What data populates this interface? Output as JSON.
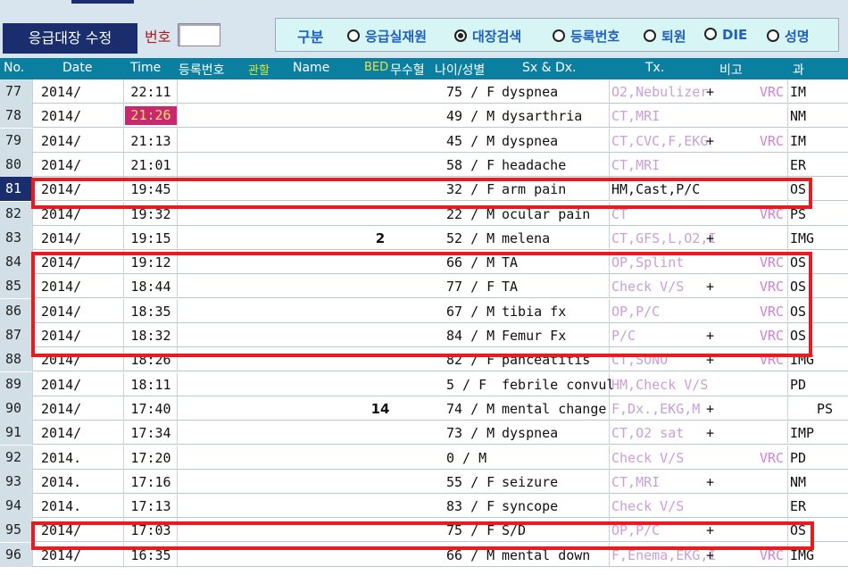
{
  "toolbar": {
    "title": "응급대장 수정",
    "number_label": "번호",
    "number_value": "",
    "group_label": "구분",
    "options": [
      {
        "label": "응급실재원",
        "selected": false
      },
      {
        "label": "대장검색",
        "selected": true
      },
      {
        "label": "등록번호",
        "selected": false
      },
      {
        "label": "퇴원",
        "selected": false
      },
      {
        "label": "DIE",
        "selected": false
      },
      {
        "label": "성명",
        "selected": false
      }
    ]
  },
  "columns": {
    "no": "No.",
    "date": "Date",
    "time": "Time",
    "reg": "등록번호",
    "dept_watch": "관할",
    "name": "Name",
    "bed": "BED",
    "trans": "무수혈",
    "age_sex": "나이/성별",
    "sxdx": "Sx & Dx.",
    "tx": "Tx.",
    "note": "비고",
    "dept": "과"
  },
  "rows": [
    {
      "no": "77",
      "date": "2014/",
      "time": "22:11",
      "bed": "",
      "age_sex": "75 / F",
      "dx": "dyspnea",
      "tx": "O2,Nebulizer",
      "tx_dark": false,
      "plus": "+",
      "vrc": "VRC",
      "dept": "IM",
      "extra": "",
      "time_hl": false,
      "active": false
    },
    {
      "no": "78",
      "date": "2014/",
      "time": "21:26",
      "bed": "",
      "age_sex": "49 / M",
      "dx": "dysarthria",
      "tx": "CT,MRI",
      "tx_dark": false,
      "plus": "",
      "vrc": "",
      "dept": "NM",
      "extra": "",
      "time_hl": true,
      "active": false
    },
    {
      "no": "79",
      "date": "2014/",
      "time": "21:13",
      "bed": "",
      "age_sex": "45 / M",
      "dx": "dyspnea",
      "tx": "CT,CVC,F,EKG",
      "tx_dark": false,
      "plus": "+",
      "vrc": "VRC",
      "dept": "IM",
      "extra": "",
      "time_hl": false,
      "active": false
    },
    {
      "no": "80",
      "date": "2014/",
      "time": "21:01",
      "bed": "",
      "age_sex": "58 / F",
      "dx": "headache",
      "tx": "CT,MRI",
      "tx_dark": false,
      "plus": "",
      "vrc": "",
      "dept": "ER",
      "extra": "",
      "time_hl": false,
      "active": false
    },
    {
      "no": "81",
      "date": "2014/",
      "time": "19:45",
      "bed": "",
      "age_sex": "32 / F",
      "dx": "arm pain",
      "tx": "HM,Cast,P/C",
      "tx_dark": true,
      "plus": "",
      "vrc": "",
      "dept": "OS",
      "extra": "",
      "time_hl": false,
      "active": true
    },
    {
      "no": "82",
      "date": "2014/",
      "time": "19:32",
      "bed": "",
      "age_sex": "22 / M",
      "dx": "ocular pain",
      "tx": "CT",
      "tx_dark": false,
      "plus": "",
      "vrc": "VRC",
      "dept": "PS",
      "extra": "",
      "time_hl": false,
      "active": false
    },
    {
      "no": "83",
      "date": "2014/",
      "time": "19:15",
      "bed": "2",
      "age_sex": "52 / M",
      "dx": "melena",
      "tx": "CT,GFS,L,O2,I",
      "tx_dark": false,
      "plus": "+",
      "vrc": "",
      "dept": "IMG",
      "extra": "",
      "time_hl": false,
      "active": false
    },
    {
      "no": "84",
      "date": "2014/",
      "time": "19:12",
      "bed": "",
      "age_sex": "66 / M",
      "dx": "TA",
      "tx": "OP,Splint",
      "tx_dark": false,
      "plus": "",
      "vrc": "VRC",
      "dept": "OS",
      "extra": "",
      "time_hl": false,
      "active": false
    },
    {
      "no": "85",
      "date": "2014/",
      "time": "18:44",
      "bed": "",
      "age_sex": "77 / F",
      "dx": "TA",
      "tx": "Check V/S",
      "tx_dark": false,
      "plus": "+",
      "vrc": "VRC",
      "dept": "OS",
      "extra": "",
      "time_hl": false,
      "active": false
    },
    {
      "no": "86",
      "date": "2014/",
      "time": "18:35",
      "bed": "",
      "age_sex": "67 / M",
      "dx": "tibia fx",
      "tx": "OP,P/C",
      "tx_dark": false,
      "plus": "",
      "vrc": "VRC",
      "dept": "OS",
      "extra": "",
      "time_hl": false,
      "active": false
    },
    {
      "no": "87",
      "date": "2014/",
      "time": "18:32",
      "bed": "",
      "age_sex": "84 / M",
      "dx": "Femur Fx",
      "tx": "P/C",
      "tx_dark": false,
      "plus": "+",
      "vrc": "VRC",
      "dept": "OS",
      "extra": "",
      "time_hl": false,
      "active": false
    },
    {
      "no": "88",
      "date": "2014/",
      "time": "18:26",
      "bed": "",
      "age_sex": "82 / F",
      "dx": "panceatitis",
      "tx": "CT,SONO",
      "tx_dark": false,
      "plus": "+",
      "vrc": "VRC",
      "dept": "IMG",
      "extra": "",
      "time_hl": false,
      "active": false
    },
    {
      "no": "89",
      "date": "2014/",
      "time": "18:11",
      "bed": "",
      "age_sex": "5 / F",
      "dx": "febrile convul",
      "tx": "HM,Check V/S",
      "tx_dark": false,
      "plus": "",
      "vrc": "",
      "dept": "PD",
      "extra": "",
      "time_hl": false,
      "active": false
    },
    {
      "no": "90",
      "date": "2014/",
      "time": "17:40",
      "bed": "14",
      "age_sex": "74 / M",
      "dx": "mental change",
      "tx": "F,Dx.,EKG,M",
      "tx_dark": false,
      "plus": "+",
      "vrc": "",
      "dept": "",
      "extra": "PS",
      "time_hl": false,
      "active": false
    },
    {
      "no": "91",
      "date": "2014/",
      "time": "17:34",
      "bed": "",
      "age_sex": "73 / M",
      "dx": "dyspnea",
      "tx": "CT,O2 sat",
      "tx_dark": false,
      "plus": "+",
      "vrc": "",
      "dept": "IMP",
      "extra": "",
      "time_hl": false,
      "active": false
    },
    {
      "no": "92",
      "date": "2014.",
      "time": "17:20",
      "bed": "",
      "age_sex": "0 / M",
      "dx": "",
      "tx": "Check V/S",
      "tx_dark": false,
      "plus": "",
      "vrc": "VRC",
      "dept": "PD",
      "extra": "",
      "time_hl": false,
      "active": false
    },
    {
      "no": "93",
      "date": "2014.",
      "time": "17:16",
      "bed": "",
      "age_sex": "55 / F",
      "dx": "seizure",
      "tx": "CT,MRI",
      "tx_dark": false,
      "plus": "+",
      "vrc": "",
      "dept": "NM",
      "extra": "",
      "time_hl": false,
      "active": false
    },
    {
      "no": "94",
      "date": "2014.",
      "time": "17:13",
      "bed": "",
      "age_sex": "83 / F",
      "dx": "syncope",
      "tx": "Check V/S",
      "tx_dark": false,
      "plus": "",
      "vrc": "",
      "dept": "ER",
      "extra": "",
      "time_hl": false,
      "active": false
    },
    {
      "no": "95",
      "date": "2014/",
      "time": "17:03",
      "bed": "",
      "age_sex": "75 / F",
      "dx": "S/D",
      "tx": "OP,P/C",
      "tx_dark": false,
      "plus": "+",
      "vrc": "",
      "dept": "OS",
      "extra": "",
      "time_hl": false,
      "active": false
    },
    {
      "no": "96",
      "date": "2014/",
      "time": "16:35",
      "bed": "",
      "age_sex": "66 / M",
      "dx": "mental down",
      "tx": "F,Enema,EKG,I",
      "tx_dark": false,
      "plus": "+",
      "vrc": "VRC",
      "dept": "IMG",
      "extra": "",
      "time_hl": false,
      "active": false
    }
  ],
  "colors": {
    "accent": "#1a2e6e",
    "highlight_box": "#e81c1c",
    "time_highlight_bg": "#c8286e",
    "header_bg": "#0a7fa0"
  }
}
